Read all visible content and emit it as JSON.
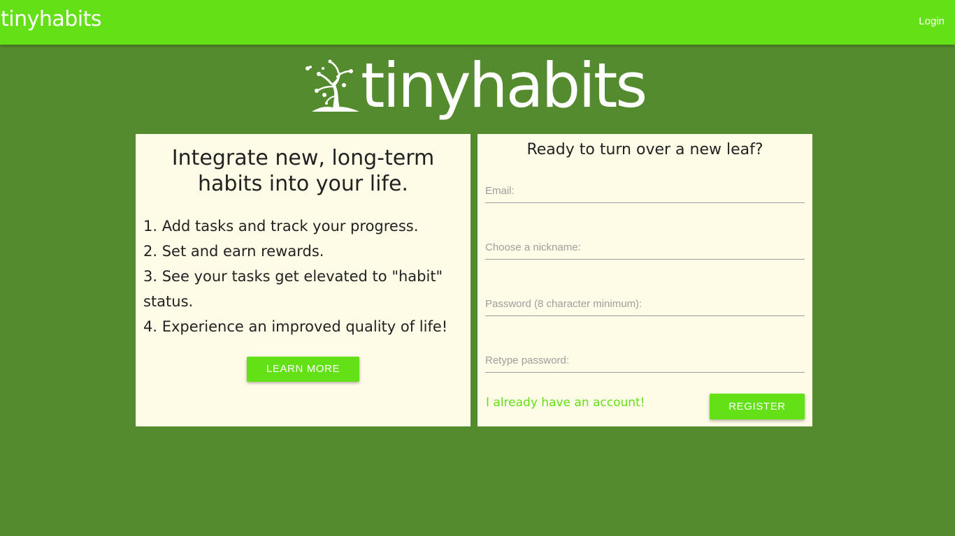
{
  "navbar": {
    "brand": "tinyhabits",
    "login_label": "Login"
  },
  "hero": {
    "logo_text": "tinyhabits",
    "logo_icon": "tree-icon"
  },
  "intro": {
    "headline": "Integrate new, long-term habits into your life.",
    "steps": [
      "1. Add tasks and track your progress.",
      "2. Set and earn rewards.",
      "3. See your tasks get elevated to \"habit\" status.",
      "4. Experience an improved quality of life!"
    ],
    "learn_more_label": "LEARN MORE"
  },
  "register": {
    "title": "Ready to turn over a new leaf?",
    "email_placeholder": "Email:",
    "nickname_placeholder": "Choose a nickname:",
    "password_placeholder": "Password (8 character minimum):",
    "retype_placeholder": "Retype password:",
    "have_account_label": "I already have an account!",
    "register_label": "REGISTER"
  },
  "colors": {
    "navbar": "#64e016",
    "background": "#548b2e",
    "card": "#fefbe6",
    "accent": "#64e016"
  }
}
